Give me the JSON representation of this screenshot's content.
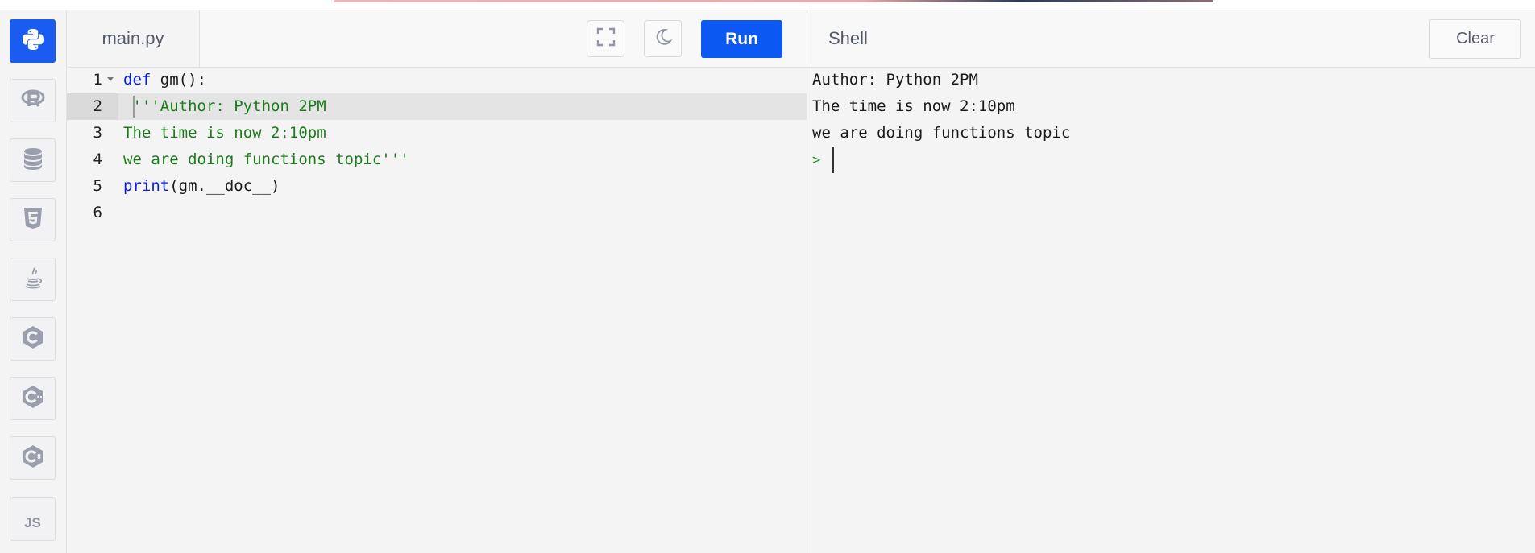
{
  "sidebar": {
    "items": [
      {
        "name": "python",
        "icon": "python-icon",
        "active": true
      },
      {
        "name": "r",
        "icon": "r-icon"
      },
      {
        "name": "sql",
        "icon": "database-icon"
      },
      {
        "name": "html",
        "icon": "html5-icon"
      },
      {
        "name": "java",
        "icon": "java-icon"
      },
      {
        "name": "c",
        "icon": "c-icon"
      },
      {
        "name": "cpp",
        "icon": "cpp-icon"
      },
      {
        "name": "csharp",
        "icon": "csharp-icon"
      },
      {
        "name": "javascript",
        "icon": "js-icon",
        "label": "JS"
      }
    ]
  },
  "editor": {
    "file_tab": "main.py",
    "fullscreen_icon": "fullscreen-icon",
    "theme_icon": "moon-icon",
    "run_label": "Run",
    "lines": [
      {
        "num": "1",
        "tokens": [
          {
            "t": "def",
            "c": "kw"
          },
          {
            "t": " gm():",
            "c": "plain"
          }
        ]
      },
      {
        "num": "2",
        "tokens": [
          {
            "t": " '''Author: Python 2PM",
            "c": "str"
          }
        ]
      },
      {
        "num": "3",
        "tokens": [
          {
            "t": "The time is now 2:10pm",
            "c": "str"
          }
        ]
      },
      {
        "num": "4",
        "tokens": [
          {
            "t": "we are doing functions topic'''",
            "c": "str"
          }
        ]
      },
      {
        "num": "5",
        "tokens": [
          {
            "t": "print",
            "c": "kw"
          },
          {
            "t": "(gm.__doc__)",
            "c": "plain"
          }
        ]
      },
      {
        "num": "6",
        "tokens": []
      }
    ]
  },
  "shell": {
    "title": "Shell",
    "clear_label": "Clear",
    "output": [
      "Author: Python 2PM",
      "The time is now 2:10pm",
      "we are doing functions topic"
    ],
    "prompt": ">"
  },
  "colors": {
    "accent": "#0b58f2",
    "keyword": "#0a1ee0",
    "string": "#1c7c1c"
  }
}
